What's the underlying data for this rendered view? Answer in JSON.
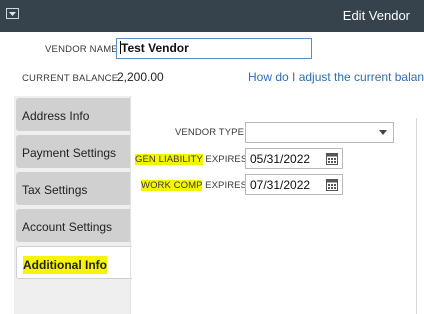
{
  "window": {
    "title": "Edit Vendor"
  },
  "header": {
    "vendor_name_label": "VENDOR NAME",
    "vendor_name_value": "Test Vendor",
    "current_balance_label": "CURRENT BALANCE",
    "current_balance_value": "2,200.00",
    "adjust_link": "How do I adjust the current balan"
  },
  "tabs": [
    {
      "label": "Address Info",
      "active": false
    },
    {
      "label": "Payment Settings",
      "active": false
    },
    {
      "label": "Tax Settings",
      "active": false
    },
    {
      "label": "Account Settings",
      "active": false
    },
    {
      "label": "Additional Info",
      "active": true
    }
  ],
  "form": {
    "vendor_type_label": "VENDOR TYPE",
    "vendor_type_value": "",
    "gen_liability_label_hl": "GEN LIABILITY",
    "gen_liability_label_rest": " EXPIRES",
    "gen_liability_value": "05/31/2022",
    "work_comp_label_hl": "WORK COMP",
    "work_comp_label_rest": " EXPIRES",
    "work_comp_value": "07/31/2022"
  },
  "icons": {
    "system_menu": "system-menu-icon",
    "dropdown": "chevron-down-icon",
    "calendar": "calendar-icon"
  },
  "colors": {
    "titlebar": "#36434d",
    "link": "#2f6db0",
    "highlight": "#f5f500",
    "tab_inactive": "#d0d0d0"
  }
}
